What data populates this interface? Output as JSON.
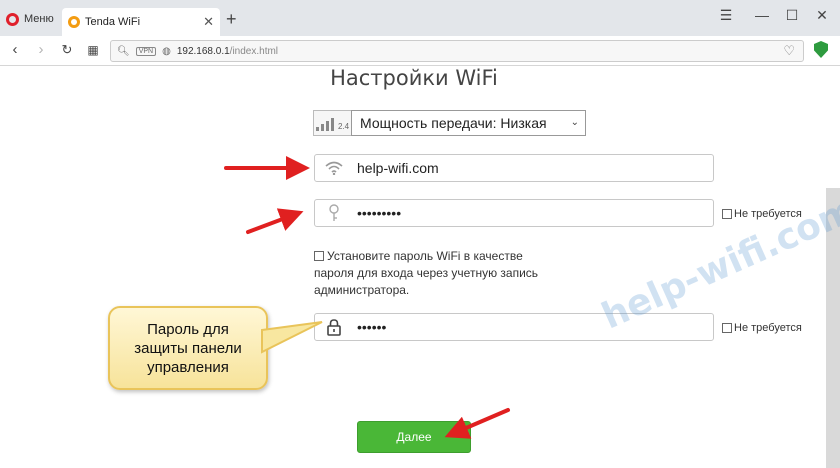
{
  "browser": {
    "menu_label": "Меню",
    "tab_title": "Tenda WiFi",
    "new_tab_symbol": "+",
    "url_host": "192.168.0.1",
    "url_path": "/index.html",
    "vpn_label": "VPN"
  },
  "page": {
    "title": "Настройки WiFi",
    "power_band": "2.4",
    "power_select_value": "Мощность передачи: Низкая",
    "ssid_value": "help-wifi.com",
    "wifi_password_value": "•••••••••",
    "wifi_password_not_required": "Не требуется",
    "same_password_label": "Установите пароль WiFi в качестве пароля для входа через учетную запись администратора.",
    "admin_password_value": "••••••",
    "admin_password_not_required": "Не требуется",
    "next_button": "Далее"
  },
  "annotations": {
    "callout_text_line1": "Пароль для",
    "callout_text_line2": "защиты панели",
    "callout_text_line3": "управления",
    "watermark": "help-wifi.com",
    "arrow_color": "#e02020"
  }
}
